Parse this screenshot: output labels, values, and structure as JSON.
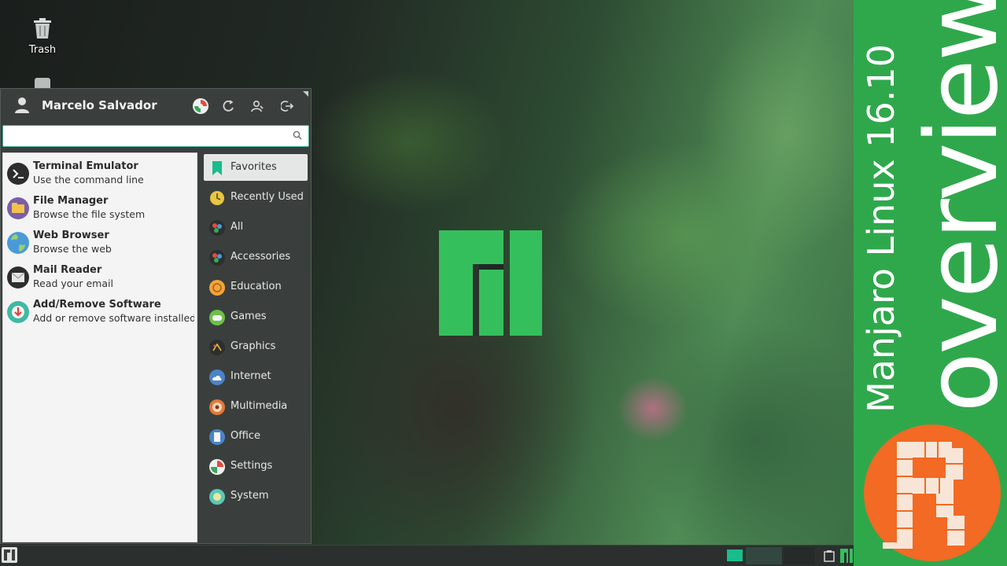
{
  "desktop": {
    "trash_label": "Trash"
  },
  "menu": {
    "user_name": "Marcelo Salvador",
    "search": {
      "value": "",
      "placeholder": ""
    },
    "favorites": [
      {
        "name": "Terminal Emulator",
        "description": "Use the command line",
        "icon": "terminal-icon"
      },
      {
        "name": "File Manager",
        "description": "Browse the file system",
        "icon": "folder-icon"
      },
      {
        "name": "Web Browser",
        "description": "Browse the web",
        "icon": "globe-icon"
      },
      {
        "name": "Mail Reader",
        "description": "Read your email",
        "icon": "mail-icon"
      },
      {
        "name": "Add/Remove Software",
        "description": "Add or remove software installed ...",
        "icon": "package-icon"
      }
    ],
    "categories": [
      {
        "label": "Favorites",
        "icon": "bookmark-icon",
        "active": true
      },
      {
        "label": "Recently Used",
        "icon": "clock-icon"
      },
      {
        "label": "All",
        "icon": "all-apps-icon"
      },
      {
        "label": "Accessories",
        "icon": "accessories-icon"
      },
      {
        "label": "Education",
        "icon": "education-icon"
      },
      {
        "label": "Games",
        "icon": "gamepad-icon"
      },
      {
        "label": "Graphics",
        "icon": "graphics-icon"
      },
      {
        "label": "Internet",
        "icon": "cloud-icon"
      },
      {
        "label": "Multimedia",
        "icon": "multimedia-icon"
      },
      {
        "label": "Office",
        "icon": "document-icon"
      },
      {
        "label": "Settings",
        "icon": "settings-icon"
      },
      {
        "label": "System",
        "icon": "system-icon"
      }
    ]
  },
  "banner": {
    "title": "Manjaro Linux 16.10",
    "subtitle": "overview",
    "logo_letter": "R"
  },
  "colors": {
    "banner_green": "#2fa84c",
    "manjaro_green": "#35bf5c",
    "menu_bg": "#3a3f3d",
    "accent_teal": "#1abc8c",
    "logo_orange": "#f26a23"
  }
}
